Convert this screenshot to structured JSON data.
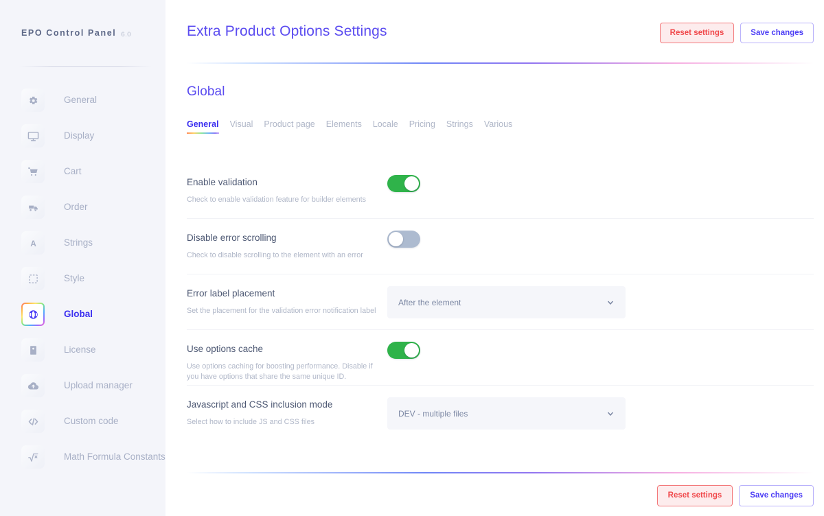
{
  "sidebar": {
    "brand": {
      "name": "EPO Control Panel",
      "version": "6.0"
    },
    "items": [
      {
        "label": "General",
        "icon": "gear-icon",
        "active": false
      },
      {
        "label": "Display",
        "icon": "monitor-icon",
        "active": false
      },
      {
        "label": "Cart",
        "icon": "cart-icon",
        "active": false
      },
      {
        "label": "Order",
        "icon": "truck-icon",
        "active": false
      },
      {
        "label": "Strings",
        "icon": "letter-a-icon",
        "active": false
      },
      {
        "label": "Style",
        "icon": "dashed-square-icon",
        "active": false
      },
      {
        "label": "Global",
        "icon": "globe-icon",
        "active": true
      },
      {
        "label": "License",
        "icon": "id-card-icon",
        "active": false
      },
      {
        "label": "Upload manager",
        "icon": "cloud-upload-icon",
        "active": false
      },
      {
        "label": "Custom code",
        "icon": "code-icon",
        "active": false
      },
      {
        "label": "Math Formula Constants",
        "icon": "square-root-icon",
        "active": false
      }
    ]
  },
  "header": {
    "title": "Extra Product Options Settings",
    "reset_label": "Reset settings",
    "save_label": "Save changes"
  },
  "section": {
    "title": "Global",
    "tabs": [
      {
        "label": "General",
        "active": true
      },
      {
        "label": "Visual",
        "active": false
      },
      {
        "label": "Product page",
        "active": false
      },
      {
        "label": "Elements",
        "active": false
      },
      {
        "label": "Locale",
        "active": false
      },
      {
        "label": "Pricing",
        "active": false
      },
      {
        "label": "Strings",
        "active": false
      },
      {
        "label": "Various",
        "active": false
      }
    ]
  },
  "settings": [
    {
      "label": "Enable validation",
      "description": "Check to enable validation feature for builder elements",
      "control": "toggle",
      "state": "on"
    },
    {
      "label": "Disable error scrolling",
      "description": "Check to disable scrolling to the element with an error",
      "control": "toggle",
      "state": "off"
    },
    {
      "label": "Error label placement",
      "description": "Set the placement for the validation error notification label",
      "control": "select",
      "value": "After the element"
    },
    {
      "label": "Use options cache",
      "description": "Use options caching for boosting performance. Disable if you have options that share the same unique ID.",
      "control": "toggle",
      "state": "on"
    },
    {
      "label": "Javascript and CSS inclusion mode",
      "description": "Select how to include JS and CSS files",
      "control": "select",
      "value": "DEV - multiple files"
    }
  ],
  "footer": {
    "reset_label": "Reset settings",
    "save_label": "Save changes"
  },
  "colors": {
    "accent": "#4b3cf5",
    "danger": "#f0484b",
    "toggle_on": "#2fb34a",
    "toggle_off": "#adbbd0",
    "sidebar_bg": "#f4f5fa",
    "muted_text": "#b0b7c8"
  }
}
